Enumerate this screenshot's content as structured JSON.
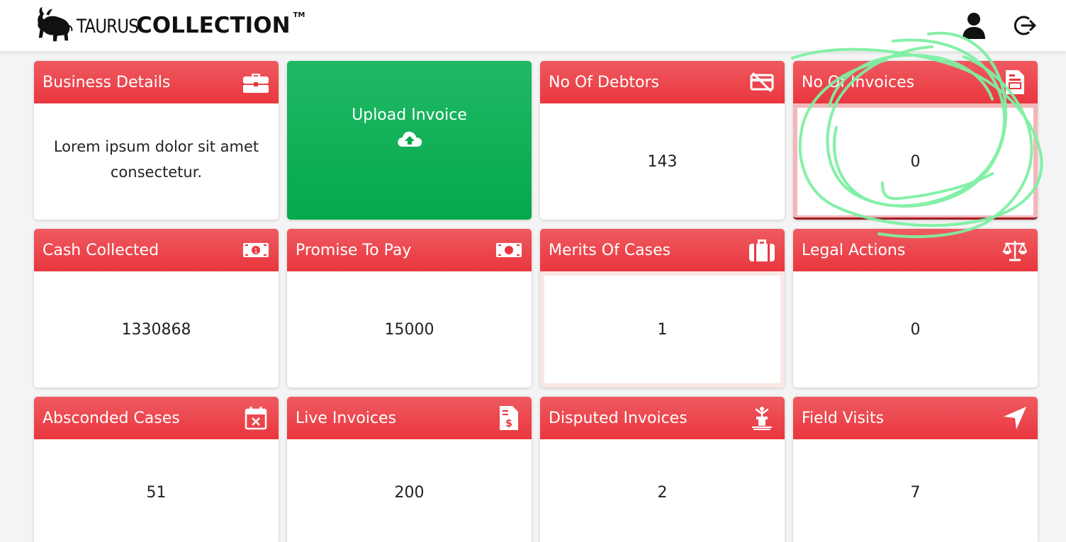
{
  "header": {
    "brand_light": "TAURUS",
    "brand_bold": "COLLECTION",
    "brand_tm": "TM",
    "user_icon": "user-icon",
    "logout_icon": "logout-icon"
  },
  "colors": {
    "card_header": "#e9363e",
    "upload_card": "#05a94c",
    "scribble": "#7ef0a3"
  },
  "cards": [
    {
      "title": "Business Details",
      "icon": "briefcase-icon",
      "description": "Lorem ipsum dolor sit amet consectetur."
    },
    {
      "title": "Upload Invoice",
      "icon": "cloud-upload-icon"
    },
    {
      "title": "No Of Debtors",
      "icon": "no-card-icon",
      "value": "143"
    },
    {
      "title": "No Of Invoices",
      "icon": "document-icon",
      "value": "0"
    },
    {
      "title": "Cash Collected",
      "icon": "money-bill-icon",
      "value": "1330868"
    },
    {
      "title": "Promise To Pay",
      "icon": "money-bill-icon",
      "value": "15000"
    },
    {
      "title": "Merits Of Cases",
      "icon": "suitcase-icon",
      "value": "1"
    },
    {
      "title": "Legal Actions",
      "icon": "scale-icon",
      "value": "0"
    },
    {
      "title": "Absconded Cases",
      "icon": "calendar-x-icon",
      "value": "51"
    },
    {
      "title": "Live Invoices",
      "icon": "invoice-dollar-icon",
      "value": "200"
    },
    {
      "title": "Disputed Invoices",
      "icon": "podium-icon",
      "value": "2"
    },
    {
      "title": "Field Visits",
      "icon": "location-arrow-icon",
      "value": "7"
    }
  ]
}
